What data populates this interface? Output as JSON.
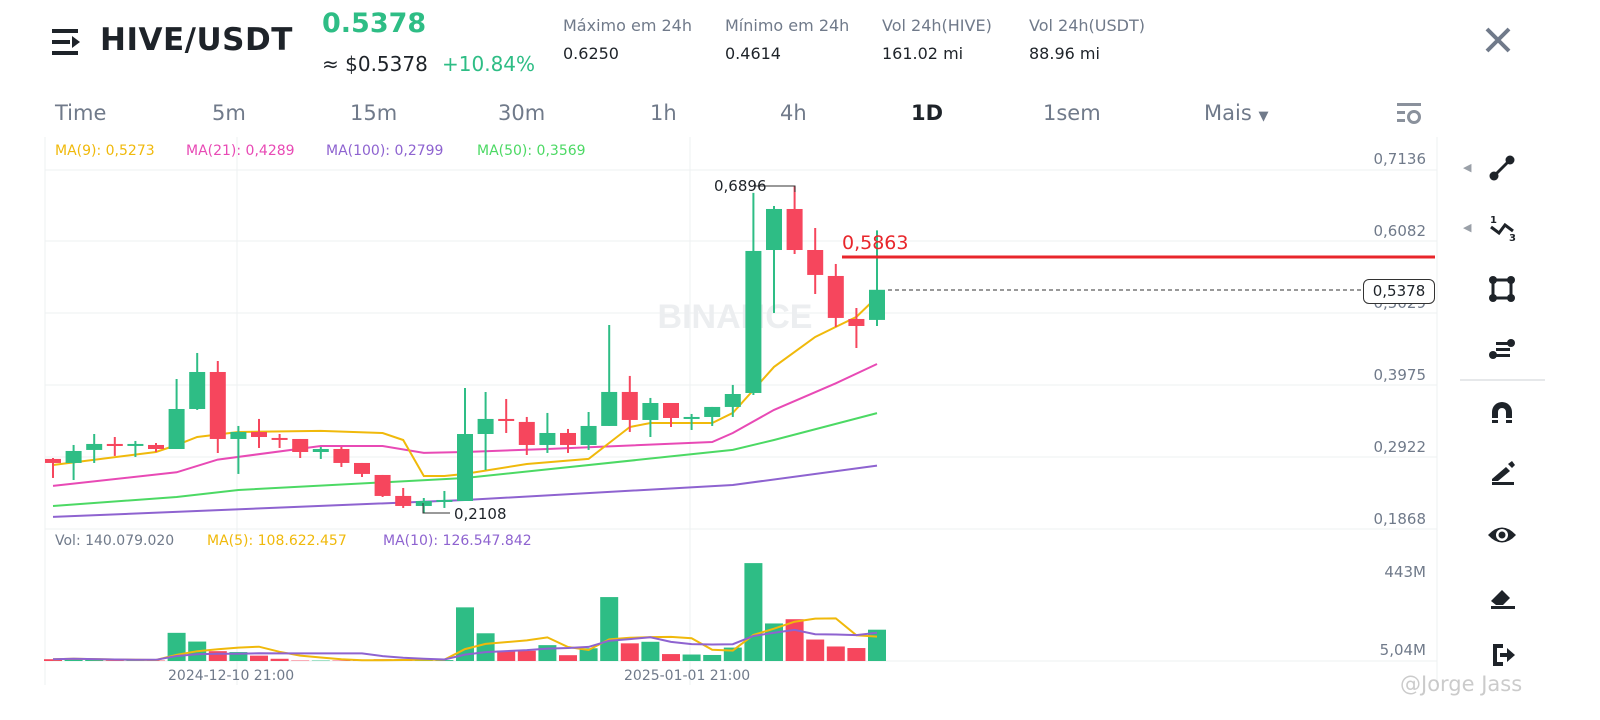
{
  "header": {
    "pair": "HIVE/USDT",
    "last_price": "0.5378",
    "approx_usd": "≈ $0.5378",
    "change": "+10.84%",
    "stats": [
      {
        "label": "Máximo em 24h",
        "value": "0.6250"
      },
      {
        "label": "Mínimo em 24h",
        "value": "0.4614"
      },
      {
        "label": "Vol 24h(HIVE)",
        "value": "161.02 mi"
      },
      {
        "label": "Vol 24h(USDT)",
        "value": "88.96 mi"
      }
    ]
  },
  "tabs": [
    {
      "label": "Time"
    },
    {
      "label": "5m"
    },
    {
      "label": "15m"
    },
    {
      "label": "30m"
    },
    {
      "label": "1h"
    },
    {
      "label": "4h"
    },
    {
      "label": "1D",
      "active": true
    },
    {
      "label": "1sem"
    },
    {
      "label": "Mais"
    }
  ],
  "legend": {
    "ma9": "MA(9): 0,5273",
    "ma21": "MA(21): 0,4289",
    "ma100": "MA(100): 0,2799",
    "ma50": "MA(50): 0,3569",
    "vol": "Vol: 140.079.020",
    "vol_ma5": "MA(5): 108.622.457",
    "vol_ma10": "MA(10): 126.547.842"
  },
  "annotations": {
    "high": "0,6896",
    "low": "0,2108",
    "line_price": "0,5863",
    "current": "0,5378"
  },
  "watermark": "BINANCE",
  "credit": "@Jorge Jass",
  "colors": {
    "up": "#2ebd85",
    "down": "#f6465d",
    "ma9": "#f0b90b",
    "ma21": "#e84ab5",
    "ma100": "#8e63d0",
    "ma50": "#4cd964",
    "line": "#e8262b"
  },
  "chart_data": {
    "type": "candlestick",
    "price_axis": {
      "ticks": [
        "0,7136",
        "0,6082",
        "0,5029",
        "0,3975",
        "0,2922",
        "0,1868"
      ],
      "range": [
        0.1868,
        0.7136
      ]
    },
    "volume_axis": {
      "ticks": [
        "443M",
        "5,04M"
      ]
    },
    "x_ticks": [
      "2024-12-10 21:00",
      "2025-01-01 21:00"
    ],
    "ohlc": [
      [
        0.2896,
        0.291,
        0.2617,
        0.2837
      ],
      [
        0.2837,
        0.3101,
        0.2587,
        0.3013
      ],
      [
        0.3028,
        0.3262,
        0.2837,
        0.3116
      ],
      [
        0.3116,
        0.3218,
        0.294,
        0.3086
      ],
      [
        0.3101,
        0.316,
        0.2925,
        0.3116
      ],
      [
        0.3101,
        0.313,
        0.2998,
        0.3042
      ],
      [
        0.3042,
        0.407,
        0.3042,
        0.3629
      ],
      [
        0.3629,
        0.4451,
        0.3615,
        0.4172
      ],
      [
        0.4172,
        0.4334,
        0.2984,
        0.3189
      ],
      [
        0.3189,
        0.338,
        0.2676,
        0.3292
      ],
      [
        0.3292,
        0.3483,
        0.3057,
        0.3218
      ],
      [
        0.3204,
        0.3262,
        0.3057,
        0.3189
      ],
      [
        0.3189,
        0.3189,
        0.291,
        0.2998
      ],
      [
        0.2998,
        0.3072,
        0.2896,
        0.3042
      ],
      [
        0.3042,
        0.3072,
        0.2778,
        0.2837
      ],
      [
        0.2837,
        0.2837,
        0.2631,
        0.2676
      ],
      [
        0.2661,
        0.2661,
        0.2338,
        0.2353
      ],
      [
        0.2353,
        0.247,
        0.2177,
        0.2206
      ],
      [
        0.2206,
        0.2323,
        0.2108,
        0.2279
      ],
      [
        0.2279,
        0.2426,
        0.2177,
        0.2294
      ],
      [
        0.2279,
        0.3937,
        0.2279,
        0.3262
      ],
      [
        0.3262,
        0.3879,
        0.2734,
        0.3483
      ],
      [
        0.3483,
        0.3776,
        0.3277,
        0.3453
      ],
      [
        0.3439,
        0.3512,
        0.2954,
        0.3101
      ],
      [
        0.3101,
        0.3571,
        0.2984,
        0.3277
      ],
      [
        0.3277,
        0.3336,
        0.2984,
        0.3101
      ],
      [
        0.3101,
        0.3585,
        0.3028,
        0.338
      ],
      [
        0.338,
        0.4862,
        0.338,
        0.3879
      ],
      [
        0.3879,
        0.4114,
        0.3292,
        0.3468
      ],
      [
        0.3468,
        0.3791,
        0.3218,
        0.3717
      ],
      [
        0.3717,
        0.3717,
        0.3365,
        0.3497
      ],
      [
        0.3483,
        0.3556,
        0.3321,
        0.3512
      ],
      [
        0.3512,
        0.3659,
        0.338,
        0.3659
      ],
      [
        0.3659,
        0.3982,
        0.3512,
        0.3849
      ],
      [
        0.3864,
        0.68,
        0.3835,
        0.5948
      ],
      [
        0.5962,
        0.6608,
        0.5038,
        0.6564
      ],
      [
        0.6564,
        0.6896,
        0.5904,
        0.5962
      ],
      [
        0.5962,
        0.6285,
        0.5317,
        0.5596
      ],
      [
        0.5581,
        0.5757,
        0.4833,
        0.4965
      ],
      [
        0.495,
        0.5111,
        0.4524,
        0.4847
      ],
      [
        0.4936,
        0.625,
        0.4847,
        0.5378
      ]
    ],
    "volume_m": [
      8,
      12,
      5,
      2,
      2,
      2,
      126,
      87,
      44,
      40,
      24,
      10,
      2,
      2,
      2,
      2,
      8,
      8,
      7,
      4,
      240,
      124,
      47,
      46,
      71,
      26,
      57,
      286,
      79,
      86,
      31,
      29,
      27,
      60,
      438,
      168,
      187,
      96,
      65,
      58,
      140.08
    ],
    "ma_anchors": {
      "ma9": [
        [
          0,
          0.2807
        ],
        [
          5,
          0.2998
        ],
        [
          6,
          0.3101
        ],
        [
          7,
          0.3218
        ],
        [
          9,
          0.3292
        ],
        [
          13,
          0.3307
        ],
        [
          16,
          0.3277
        ],
        [
          17,
          0.3174
        ],
        [
          18,
          0.2646
        ],
        [
          19,
          0.2646
        ],
        [
          20,
          0.2676
        ],
        [
          23,
          0.2822
        ],
        [
          26,
          0.2896
        ],
        [
          28,
          0.3365
        ],
        [
          29,
          0.3424
        ],
        [
          32,
          0.3424
        ],
        [
          33,
          0.3571
        ],
        [
          34,
          0.3908
        ],
        [
          35,
          0.4246
        ],
        [
          37,
          0.4686
        ],
        [
          38,
          0.4833
        ],
        [
          39,
          0.498
        ],
        [
          40,
          0.5273
        ]
      ],
      "ma21": [
        [
          0,
          0.25
        ],
        [
          6,
          0.27
        ],
        [
          8,
          0.2887
        ],
        [
          13,
          0.3086
        ],
        [
          16,
          0.3086
        ],
        [
          18,
          0.2984
        ],
        [
          20,
          0.2998
        ],
        [
          24,
          0.3042
        ],
        [
          32,
          0.3145
        ],
        [
          33,
          0.3277
        ],
        [
          35,
          0.3615
        ],
        [
          38,
          0.4006
        ],
        [
          40,
          0.4289
        ]
      ],
      "ma50": [
        [
          0,
          0.2206
        ],
        [
          6,
          0.2338
        ],
        [
          9,
          0.2441
        ],
        [
          20,
          0.2617
        ],
        [
          33,
          0.3028
        ],
        [
          35,
          0.3174
        ],
        [
          40,
          0.3569
        ]
      ],
      "ma100": [
        [
          0,
          0.2045
        ],
        [
          20,
          0.2294
        ],
        [
          33,
          0.2514
        ],
        [
          40,
          0.2799
        ]
      ]
    }
  }
}
